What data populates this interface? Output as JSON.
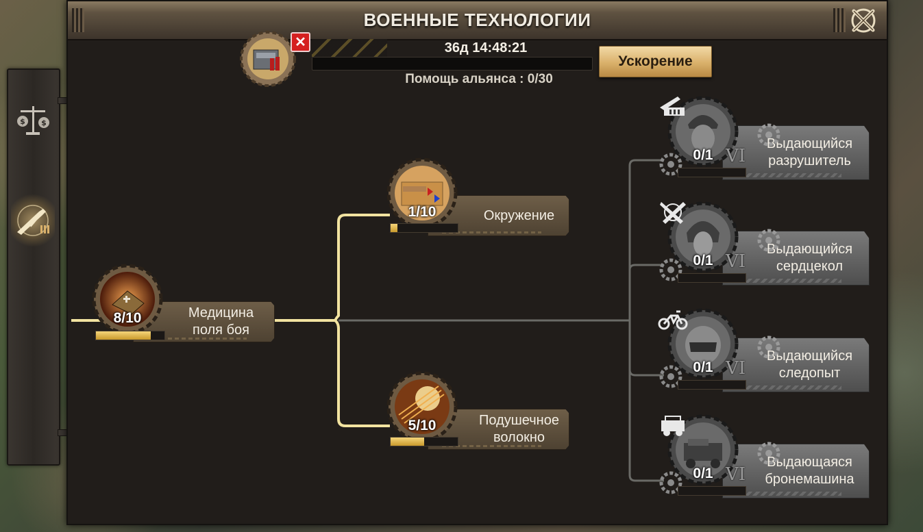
{
  "window": {
    "title": "ВОЕННЫЕ ТЕХНОЛОГИИ"
  },
  "research": {
    "timer": "36д 14:48:21",
    "alliance_help": "Помощь альянса : 0/30",
    "speed_button": "Ускорение",
    "progress": 0
  },
  "side_tabs": [
    {
      "icon": "scales-money-icon",
      "active": false
    },
    {
      "icon": "rifle-icon",
      "active": true
    }
  ],
  "tree": {
    "root": {
      "name": "Медицина поля боя",
      "line1": "Медицина",
      "line2": "поля боя",
      "level": "8/10",
      "progress": 0.8,
      "icon": "medicine-crate-icon"
    },
    "tier2": [
      {
        "name": "Окружение",
        "line1": "Окружение",
        "line2": "",
        "level": "1/10",
        "progress": 0.1,
        "icon": "battle-map-icon"
      },
      {
        "name": "Подушечное волокно",
        "line1": "Подушечное",
        "line2": "волокно",
        "level": "5/10",
        "progress": 0.5,
        "icon": "fiber-icon"
      }
    ],
    "tier3": [
      {
        "line1": "Выдающийся",
        "line2": "разрушитель",
        "level": "0/1",
        "roman": "VI",
        "progress": 0,
        "class_icon": "artillery-truck-icon",
        "portrait": "soldier-helmet-icon"
      },
      {
        "line1": "Выдающийся",
        "line2": "сердцекол",
        "level": "0/1",
        "roman": "VI",
        "progress": 0,
        "class_icon": "crossed-knives-icon",
        "portrait": "female-soldier-icon"
      },
      {
        "line1": "Выдающийся",
        "line2": "следопыт",
        "level": "0/1",
        "roman": "VI",
        "progress": 0,
        "class_icon": "motorcycle-icon",
        "portrait": "biker-helmet-icon"
      },
      {
        "line1": "Выдающаяся",
        "line2": "бронемашина",
        "level": "0/1",
        "roman": "VI",
        "progress": 0,
        "class_icon": "jeep-icon",
        "portrait": "armored-vehicle-icon"
      }
    ]
  },
  "colors": {
    "active_line": "#f2e3a0",
    "inactive_line": "#6a6a66",
    "progress_fill": "#e8c04a",
    "accent_button": "#d9b06a"
  }
}
